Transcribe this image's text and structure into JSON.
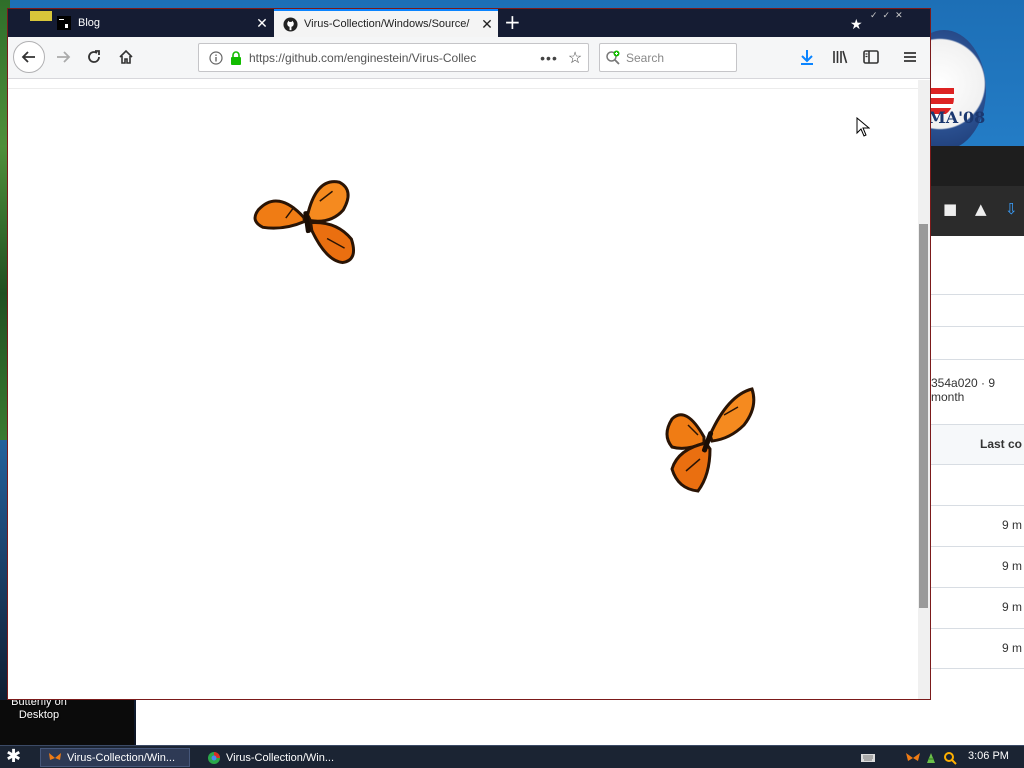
{
  "tabs": [
    {
      "title": "Blog",
      "active": false
    },
    {
      "title": "Virus-Collection/Windows/Source/",
      "active": true
    }
  ],
  "navbar": {
    "url": "https://github.com/enginestein/Virus-Collec",
    "search_placeholder": "Search"
  },
  "background_window": {
    "commit_text": "354a020 · 9 month",
    "last_commit_header": "Last co",
    "ages": [
      "9 m",
      "9 m",
      "9 m",
      "9 m"
    ]
  },
  "desktop": {
    "icon_label": "Butterfly on Desktop",
    "logo_text": "MA'08"
  },
  "taskbar": {
    "items": [
      {
        "label": "Virus-Collection/Win..."
      },
      {
        "label": "Virus-Collection/Win..."
      }
    ],
    "clock": "3:06 PM"
  },
  "colors": {
    "tabbar": "#151c33",
    "active_tab_accent": "#0a84ff",
    "lock_green": "#12bc00",
    "download_blue": "#0a84ff",
    "butterfly_orange": "#f07c14"
  }
}
